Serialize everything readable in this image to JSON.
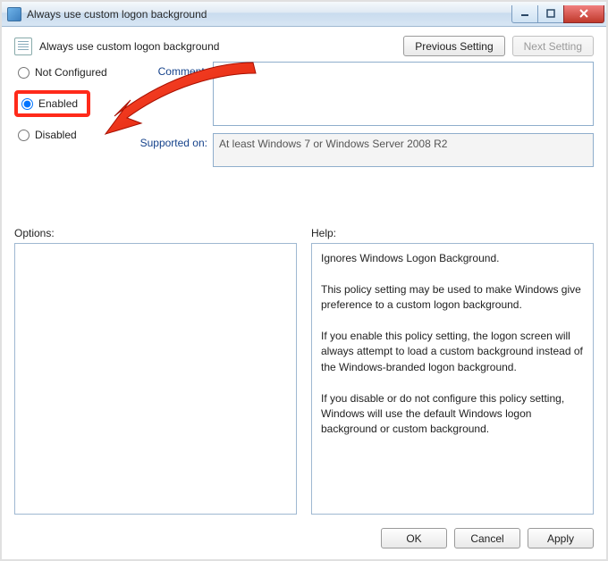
{
  "window": {
    "title": "Always use custom logon background"
  },
  "header": {
    "policy_title": "Always use custom logon background",
    "previous_label": "Previous Setting",
    "next_label": "Next Setting"
  },
  "state_radios": {
    "not_configured": "Not Configured",
    "enabled": "Enabled",
    "disabled": "Disabled",
    "selected": "enabled"
  },
  "labels": {
    "comment": "Comment:",
    "supported_on": "Supported on:",
    "options": "Options:",
    "help": "Help:"
  },
  "comment_value": "",
  "supported_text": "At least Windows 7 or Windows Server 2008 R2",
  "help_text": {
    "p1": "Ignores Windows Logon Background.",
    "p2": "This policy setting may be used to make Windows give preference to a custom logon background.",
    "p3": "If you enable this policy setting, the logon screen will always attempt to load a custom background instead of the Windows-branded logon background.",
    "p4": "If you disable or do not configure this policy setting, Windows will use the default Windows logon background or custom background."
  },
  "footer": {
    "ok": "OK",
    "cancel": "Cancel",
    "apply": "Apply"
  }
}
